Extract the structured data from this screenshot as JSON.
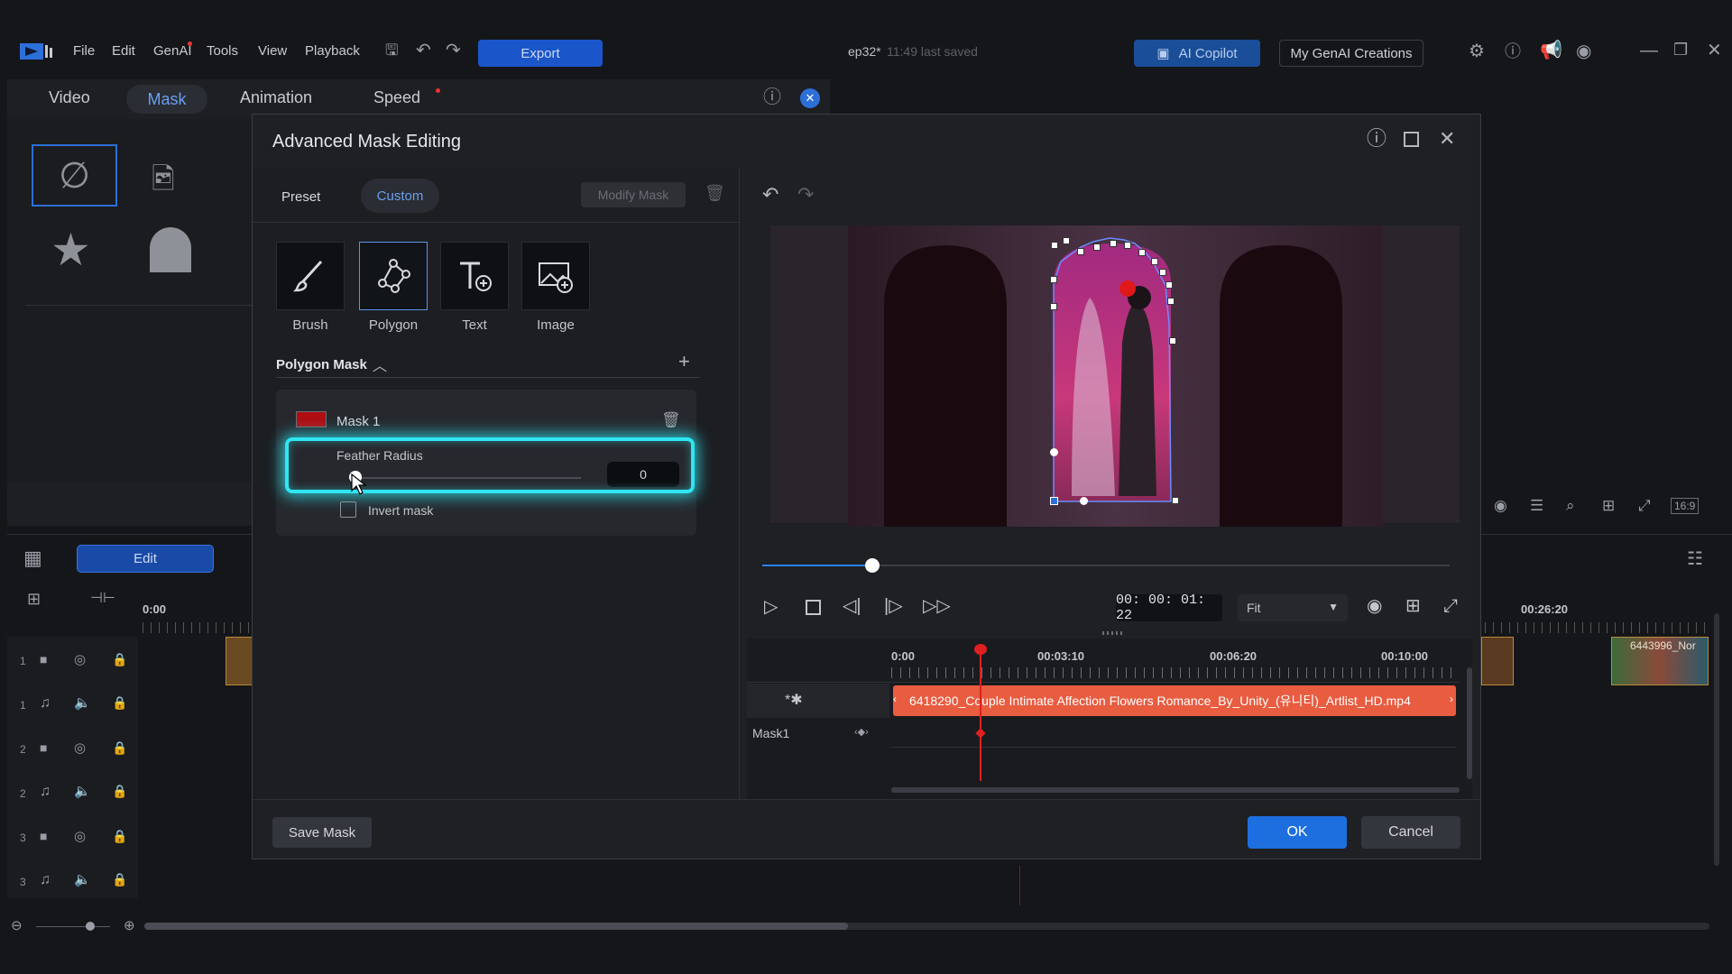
{
  "titlebar": {
    "menus": [
      "File",
      "Edit",
      "GenAI",
      "Tools",
      "View",
      "Playback"
    ],
    "export_label": "Export",
    "project_title": "ep32*",
    "save_status": "11:49 last saved",
    "ai_copilot_label": "AI Copilot",
    "my_genai_label": "My GenAI Creations"
  },
  "tabs": [
    "Video",
    "Mask",
    "Animation",
    "Speed"
  ],
  "background": {
    "edit_label": "Edit",
    "ruler_start": "0:00",
    "ruler_end": "00:26:20",
    "right_clip_label": "6443996_Nor",
    "track_numbers": [
      "1",
      "1",
      "2",
      "2",
      "3",
      "3"
    ],
    "aspect_label": "16:9"
  },
  "dialog": {
    "title": "Advanced Mask Editing",
    "preset_label": "Preset",
    "custom_label": "Custom",
    "modify_mask_label": "Modify Mask",
    "tools": [
      "Brush",
      "Polygon",
      "Text",
      "Image"
    ],
    "selected_tool": "Polygon",
    "section_title": "Polygon Mask",
    "mask_name": "Mask 1",
    "mask_color": "#b00d12",
    "feather_label": "Feather Radius",
    "feather_value": "0",
    "invert_label": "Invert mask",
    "invert_checked": false,
    "playback_progress": 0.16,
    "timecode": "00: 00: 01: 22",
    "zoom_option": "Fit",
    "ruler_ticks": [
      "0:00",
      "00:03:10",
      "00:06:20",
      "00:10:00"
    ],
    "clip_name": "6418290_Couple Intimate Affection Flowers Romance_By_Unity_(유니티)_Artlist_HD.mp4",
    "track_label": "Mask1",
    "save_mask_label": "Save Mask",
    "ok_label": "OK",
    "cancel_label": "Cancel"
  },
  "colors": {
    "accent": "#1d6fe0",
    "highlight": "#2fe6f2",
    "clip": "#e85c40",
    "playhead": "#e02020"
  }
}
